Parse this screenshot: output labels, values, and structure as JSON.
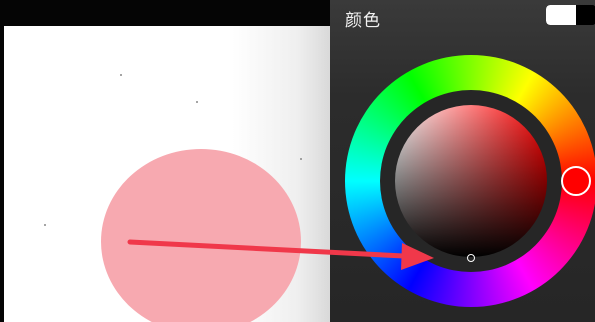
{
  "panel": {
    "title": "颜色"
  },
  "colors": {
    "paper": "#ffffff",
    "shape_fill": "#f7a9b0",
    "panel_background": "#2c2c2c",
    "primary_swatch": "#ffffff",
    "secondary_swatch": "#000000",
    "selected_hue": "#ff0000",
    "annotation_arrow": "#f0384a"
  },
  "icons": {
    "annotation": "arrow-right-icon"
  }
}
